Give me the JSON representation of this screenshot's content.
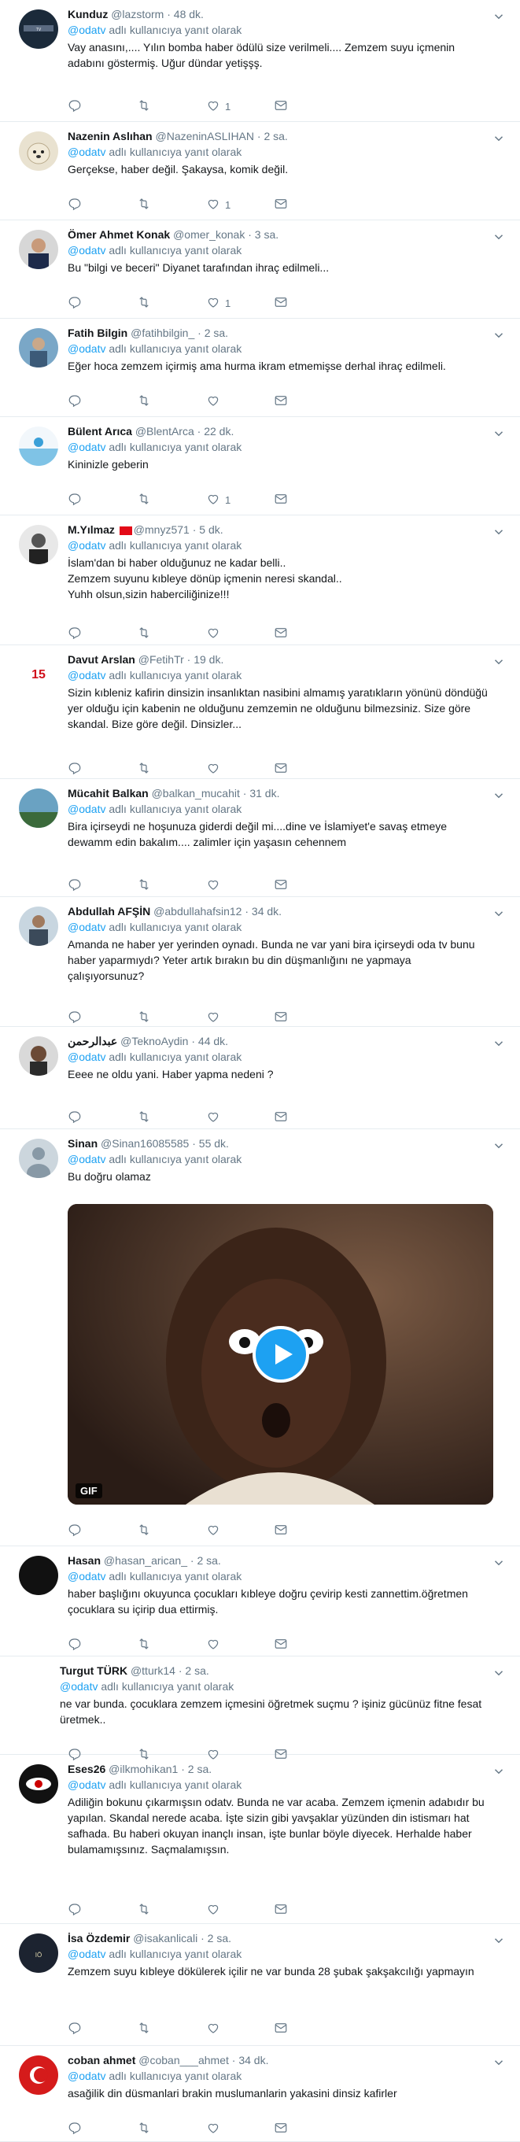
{
  "tweets": [
    {
      "name": "Kunduz",
      "handle": "@lazstorm",
      "time": "48 dk.",
      "reply_prefix": "@odatv",
      "reply_suffix": "adlı kullanıcıya yanıt olarak",
      "text": "Vay anasını,.... Yılın bomba haber ödülü size verilmeli.... Zemzem suyu içmenin adabını göstermiş. Uğur dündar yetişşş.",
      "likes": "1"
    },
    {
      "name": "Nazenin Aslıhan",
      "handle": "@NazeninASLIHAN",
      "time": "2 sa.",
      "reply_prefix": "@odatv",
      "reply_suffix": "adlı kullanıcıya yanıt olarak",
      "text": "Gerçekse, haber değil. Şakaysa, komik değil.",
      "likes": "1"
    },
    {
      "name": "Ömer Ahmet Konak",
      "handle": "@omer_konak",
      "time": "3 sa.",
      "reply_prefix": "@odatv",
      "reply_suffix": "adlı kullanıcıya yanıt olarak",
      "text": "Bu \"bilgi ve beceri\" Diyanet tarafından ihraç edilmeli...",
      "likes": "1"
    },
    {
      "name": "Fatih Bilgin",
      "handle": "@fatihbilgin_",
      "time": "2 sa.",
      "reply_prefix": "@odatv",
      "reply_suffix": "adlı kullanıcıya yanıt olarak",
      "text": "Eğer hoca zemzem içirmiş ama hurma ikram etmemişse derhal ihraç edilmeli.",
      "likes": ""
    },
    {
      "name": "Bülent Arıca",
      "handle": "@BlentArca",
      "time": "22 dk.",
      "reply_prefix": "@odatv",
      "reply_suffix": "adlı kullanıcıya yanıt olarak",
      "text": "Kininizle geberin",
      "likes": "1"
    },
    {
      "name": "M.Yılmaz",
      "handle": "@mnyz571",
      "time": "5 dk.",
      "reply_prefix": "@odatv",
      "reply_suffix": "adlı kullanıcıya yanıt olarak",
      "text": "İslam'dan bi haber olduğunuz ne kadar belli..\nZemzem suyunu kıbleye dönüp içmenin neresi skandal..\nYuhh olsun,sizin haberciliğinize!!!",
      "likes": ""
    },
    {
      "name": "Davut Arslan",
      "handle": "@FetihTr",
      "time": "19 dk.",
      "reply_prefix": "@odatv",
      "reply_suffix": "adlı kullanıcıya yanıt olarak",
      "text": "Sizin kıbleniz kafirin dinsizin insanlıktan nasibini almamış yaratıkların yönünü döndüğü yer olduğu için kabenin ne olduğunu zemzemin ne olduğunu bilmezsiniz. Size göre skandal. Bize göre değil. Dinsizler...",
      "likes": ""
    },
    {
      "name": "Mücahit Balkan",
      "handle": "@balkan_mucahit",
      "time": "31 dk.",
      "reply_prefix": "@odatv",
      "reply_suffix": "adlı kullanıcıya yanıt olarak",
      "text": "Bira içirseydi ne hoşunuza giderdi değil mi....dine ve İslamiyet'e savaş etmeye dewamm edin bakalım.... zalimler için yaşasın cehennem",
      "likes": ""
    },
    {
      "name": "Abdullah AFŞİN",
      "handle": "@abdullahafsin12",
      "time": "34 dk.",
      "reply_prefix": "@odatv",
      "reply_suffix": "adlı kullanıcıya yanıt olarak",
      "text": "Amanda ne haber yer yerinden oynadı. Bunda ne var yani bira içirseydi oda tv bunu haber yaparmıydı? Yeter artık bırakın bu din düşmanlığını ne yapmaya çalışıyorsunuz?",
      "likes": ""
    },
    {
      "name": "عبدالرحمن",
      "handle": "@TeknoAydin",
      "time": "44 dk.",
      "reply_prefix": "@odatv",
      "reply_suffix": "adlı kullanıcıya yanıt olarak",
      "text": "Eeee ne oldu yani. Haber yapma nedeni ?",
      "likes": ""
    },
    {
      "name": "Sinan",
      "handle": "@Sinan16085585",
      "time": "55 dk.",
      "reply_prefix": "@odatv",
      "reply_suffix": "adlı kullanıcıya yanıt olarak",
      "text": "Bu doğru olamaz",
      "likes": "",
      "gif_label": "GIF"
    },
    {
      "name": "Hasan",
      "handle": "@hasan_arican_",
      "time": "2 sa.",
      "reply_prefix": "@odatv",
      "reply_suffix": "adlı kullanıcıya yanıt olarak",
      "text": "haber başlığını okuyunca çocukları kıbleye doğru çevirip kesti zannettim.öğretmen çocuklara su içirip dua ettirmiş.",
      "likes": ""
    },
    {
      "name": "Turgut TÜRK",
      "handle": "@tturk14",
      "time": "2 sa.",
      "reply_prefix": "@odatv",
      "reply_suffix": "adlı kullanıcıya yanıt olarak",
      "text": "ne var  bunda.  çocuklara zemzem  içmesini öğretmek suçmu ?  işiniz gücünüz fitne fesat  üretmek..",
      "likes": ""
    },
    {
      "name": "Eses26",
      "handle": "@ilkmohikan1",
      "time": "2 sa.",
      "reply_prefix": "@odatv",
      "reply_suffix": "adlı kullanıcıya yanıt olarak",
      "text": "Adiliğin bokunu çıkarmışsın odatv. Bunda ne var acaba. Zemzem içmenin adabıdır bu yapılan. Skandal nerede acaba. İşte sizin gibi yavşaklar yüzünden din istismarı hat safhada. Bu haberi okuyan inançlı insan, işte bunlar böyle diyecek. Herhalde haber bulamamışsınız. Saçmalamışsın.",
      "likes": ""
    },
    {
      "name": "İsa Özdemir",
      "handle": "@isakanlicali",
      "time": "2 sa.",
      "reply_prefix": "@odatv",
      "reply_suffix": "adlı kullanıcıya yanıt olarak",
      "text": "Zemzem suyu kıbleye dökülerek içilir ne var bunda 28 şubak şakşakcılığı yapmayın",
      "likes": ""
    },
    {
      "name": "coban ahmet",
      "handle": "@coban___ahmet",
      "time": "34 dk.",
      "reply_prefix": "@odatv",
      "reply_suffix": "adlı kullanıcıya yanıt olarak",
      "text": "asağilik din düsmanlari brakin muslumanlarin yakasini dinsiz kafirler",
      "likes": ""
    }
  ],
  "colors": {
    "accent": "#1da1f2",
    "muted": "#657786",
    "text": "#14171a",
    "border": "#e6ecf0"
  },
  "icons": {
    "reply": "reply-icon",
    "retweet": "retweet-icon",
    "like": "like-icon",
    "dm": "envelope-icon",
    "caret": "chevron-down-icon",
    "play": "play-icon"
  }
}
